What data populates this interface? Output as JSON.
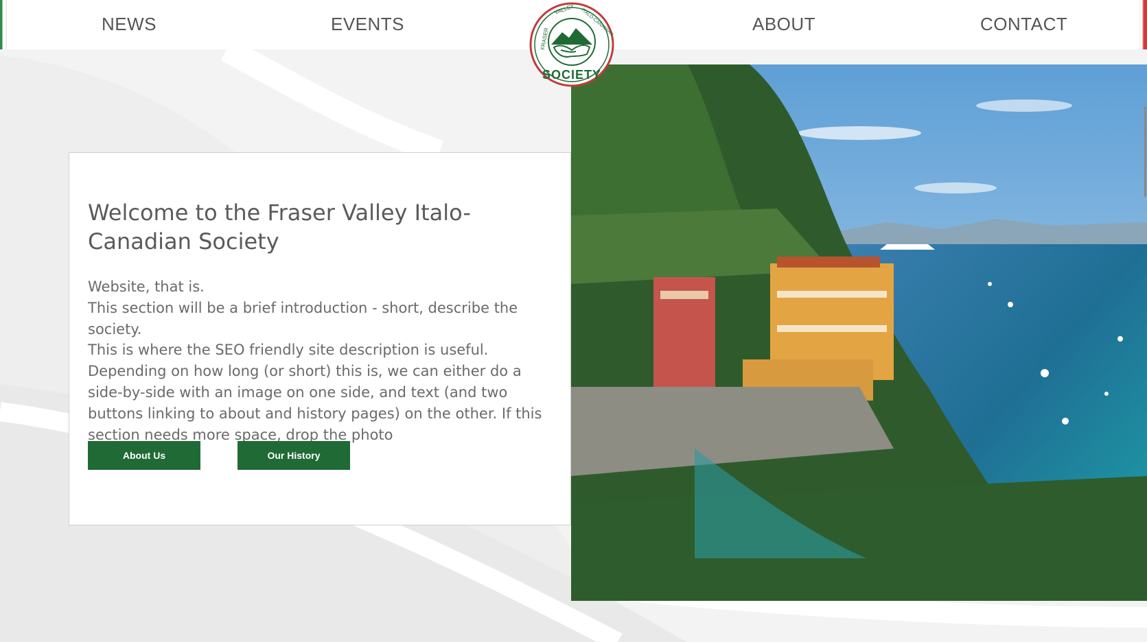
{
  "nav": {
    "items": [
      {
        "label": "NEWS"
      },
      {
        "label": "EVENTS"
      },
      {
        "label": "ABOUT"
      },
      {
        "label": "CONTACT"
      }
    ]
  },
  "logo": {
    "text": "FRASER VALLEY ITALO-CANADIAN SOCIETY",
    "colors": {
      "ring": "#c23b3b",
      "green": "#1f6a35"
    }
  },
  "hero": {
    "title": "Welcome to the Fraser Valley Italo-Canadian Society",
    "lines": [
      "Website, that is.",
      "This section will be a brief introduction - short, describe the society.",
      "This is where the SEO friendly site description is useful. Depending on how long (or short) this is, we can either do a side-by-side with an image on one side, and text (and two buttons linking to about and history pages) on the other. If this section needs more space, drop the photo"
    ],
    "buttons": {
      "about": "About Us",
      "history": "Our History"
    }
  },
  "colors": {
    "button": "#1f6a35",
    "nav_text": "#555555",
    "flag_green": "#2e8b4a",
    "flag_red": "#d23a3a"
  },
  "photo": {
    "subject": "coastal-village-photo"
  }
}
